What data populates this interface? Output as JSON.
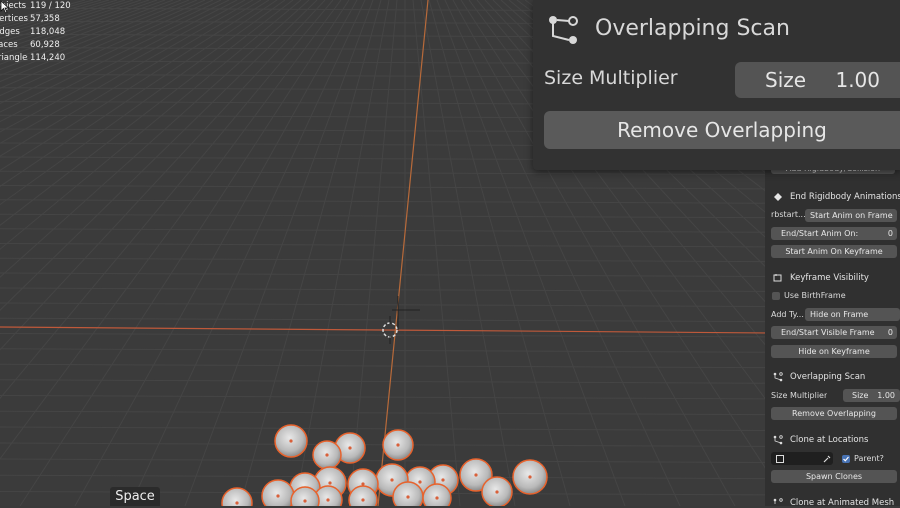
{
  "stats": [
    {
      "key": "Objects",
      "value": "119 / 120"
    },
    {
      "key": "Vertices",
      "value": "57,358"
    },
    {
      "key": "Edges",
      "value": "118,048"
    },
    {
      "key": "Faces",
      "value": "60,928"
    },
    {
      "key": "Triangles",
      "value": "114,240"
    }
  ],
  "viewport": {
    "space_label": "Space"
  },
  "popup": {
    "title": "Overlapping Scan",
    "size_label": "Size Multiplier",
    "size_key": "Size",
    "size_value": "1.00",
    "remove_button": "Remove Overlapping"
  },
  "panel": {
    "add_rigidbody": "Add Rigidbody/Collision",
    "end_rigidbody_header": "End Rigidbody Animations",
    "rbstart_label": "rbstart...",
    "rbstart_value": "Start Anim on Frame",
    "end_start_anim_label": "End/Start Anim On:",
    "end_start_anim_value": "0",
    "start_anim_keyframe": "Start Anim On Keyframe",
    "keyframe_visibility_header": "Keyframe Visibility",
    "use_birthframe": "Use BirthFrame",
    "add_type_label": "Add Ty...",
    "add_type_value": "Hide on Frame",
    "end_start_visible_label": "End/Start Visible Frame",
    "end_start_visible_value": "0",
    "hide_on_keyframe": "Hide on Keyframe",
    "overlapping_header": "Overlapping Scan",
    "size_multiplier": "Size Multiplier",
    "size_key": "Size",
    "size_value": "1.00",
    "remove_overlapping": "Remove Overlapping",
    "clone_locations_header": "Clone at Locations",
    "parent_label": "Parent?",
    "spawn_clones": "Spawn Clones",
    "clone_animated_header": "Clone at Animated Mesh"
  }
}
